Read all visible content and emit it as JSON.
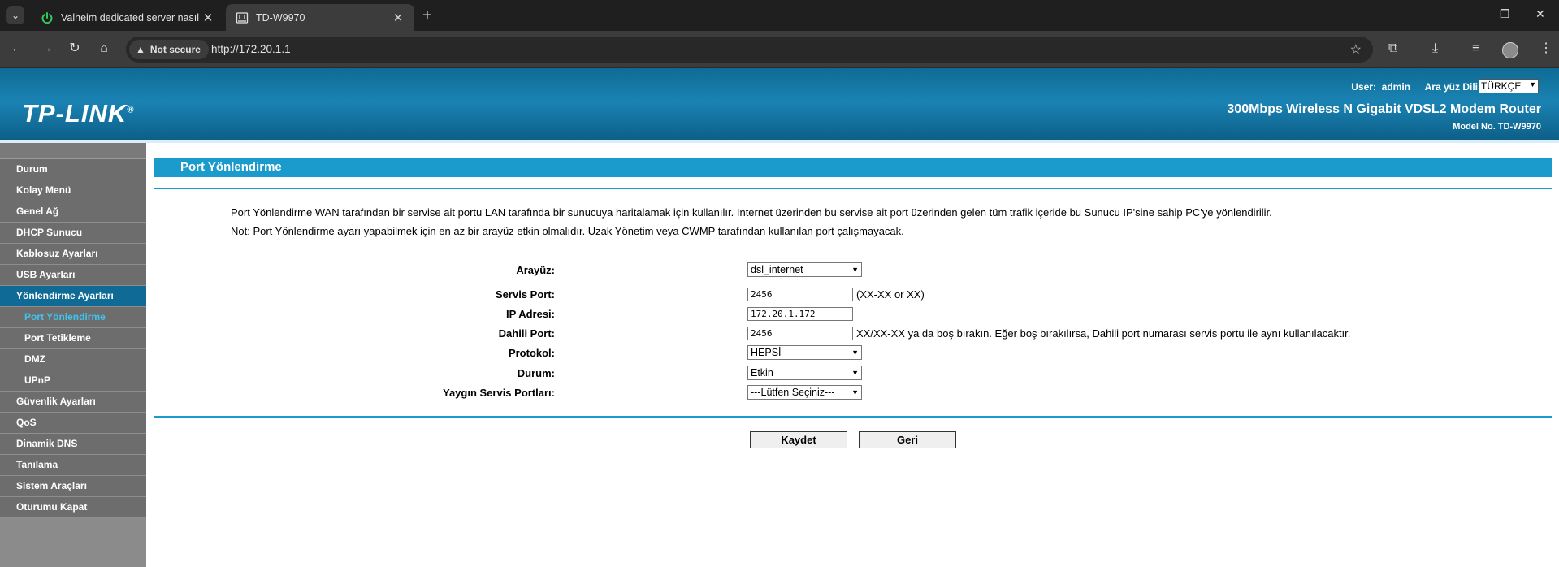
{
  "browser": {
    "tabs": [
      {
        "title": "Valheim dedicated server nasıl k",
        "active": false,
        "favicon": "power-icon"
      },
      {
        "title": "TD-W9970",
        "active": true,
        "favicon": "router-page-icon"
      }
    ],
    "security_label": "Not secure",
    "url": "http://172.20.1.1"
  },
  "header": {
    "logo_text": "TP-LINK",
    "logo_mark": "®",
    "user_label": "User:",
    "user_name": "admin",
    "lang_label": "Ara yüz Dili",
    "lang_value": "TÜRKÇE",
    "model_title": "300Mbps Wireless N Gigabit VDSL2 Modem Router",
    "model_no": "Model No. TD-W9970",
    "colors": {
      "header_blue": "#0f6b95",
      "accent": "#1b9bcb"
    }
  },
  "sidebar": {
    "items": [
      {
        "label": "Durum"
      },
      {
        "label": "Kolay Menü"
      },
      {
        "label": "Genel Ağ"
      },
      {
        "label": "DHCP Sunucu"
      },
      {
        "label": "Kablosuz Ayarları"
      },
      {
        "label": "USB Ayarları"
      },
      {
        "label": "Yönlendirme Ayarları"
      },
      {
        "label": "Port Yönlendirme"
      },
      {
        "label": "Port Tetikleme"
      },
      {
        "label": "DMZ"
      },
      {
        "label": "UPnP"
      },
      {
        "label": "Güvenlik Ayarları"
      },
      {
        "label": "QoS"
      },
      {
        "label": "Dinamik DNS"
      },
      {
        "label": "Tanılama"
      },
      {
        "label": "Sistem Araçları"
      },
      {
        "label": "Oturumu Kapat"
      }
    ]
  },
  "main": {
    "title": "Port Yönlendirme",
    "desc1": "Port Yönlendirme WAN tarafından bir servise ait portu LAN tarafında bir sunucuya haritalamak için kullanılır. Internet üzerinden bu servise ait port üzerinden gelen tüm trafik içeride bu Sunucu IP'sine sahip PC'ye yönlendirilir.",
    "desc2": "Not: Port Yönlendirme ayarı yapabilmek için en az bir arayüz etkin olmalıdır. Uzak Yönetim veya CWMP tarafından kullanılan port çalışmayacak.",
    "form": {
      "interface_label": "Arayüz:",
      "interface_value": "dsl_internet",
      "service_port_label": "Servis Port:",
      "service_port_value": "2456",
      "service_port_hint": "(XX-XX or XX)",
      "ip_label": "IP Adresi:",
      "ip_value": "172.20.1.172",
      "internal_port_label": "Dahili Port:",
      "internal_port_value": "2456",
      "internal_port_hint": "XX/XX-XX ya da boş bırakın. Eğer boş bırakılırsa, Dahili port numarası servis portu ile aynı kullanılacaktır.",
      "protocol_label": "Protokol:",
      "protocol_value": "HEPSİ",
      "status_label": "Durum:",
      "status_value": "Etkin",
      "common_ports_label": "Yaygın Servis Portları:",
      "common_ports_value": "---Lütfen Seçiniz---"
    },
    "save_label": "Kaydet",
    "back_label": "Geri"
  }
}
